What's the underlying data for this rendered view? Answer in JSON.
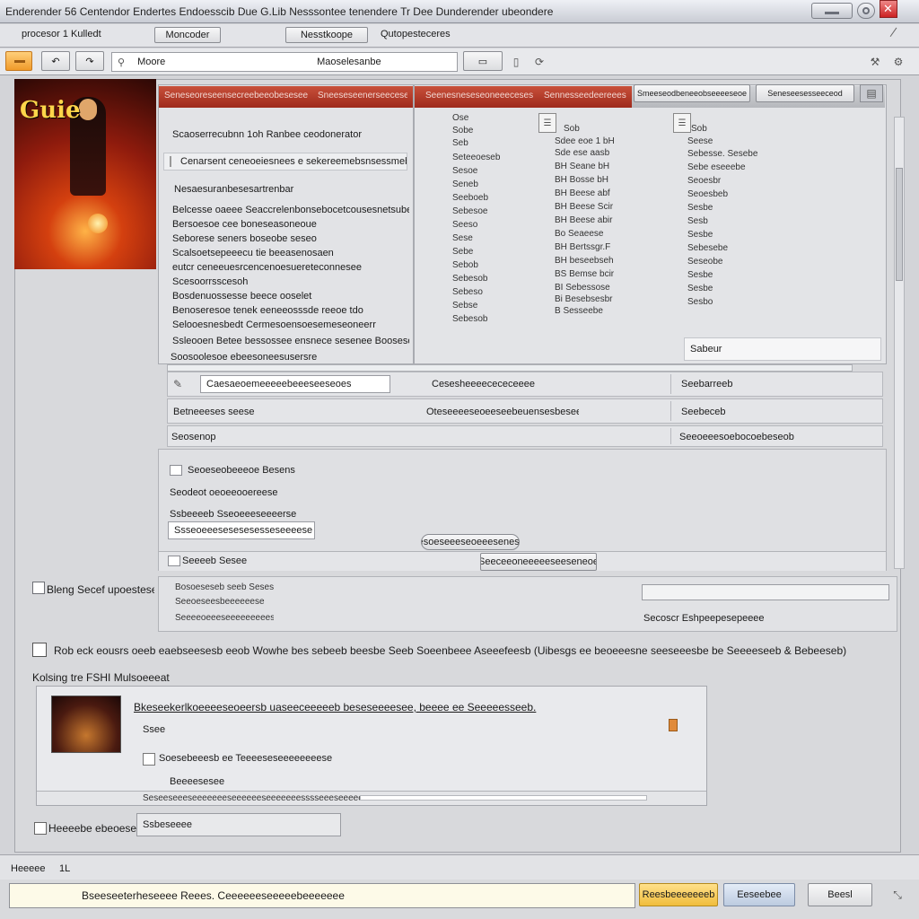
{
  "window": {
    "title": "Enderender 56 Centendor Endertes Endoesscib Due G.Lib Nesssontee tenendere Tr Dee Dunderender ubeondere"
  },
  "tabs": [
    "procesor 1 Kulledt",
    "Moncoder",
    "Nesstkoope",
    "Qutopesteceres"
  ],
  "toolbar": {
    "path": "Moore",
    "location": "Maoselesanbe"
  },
  "left_list": {
    "heading": "Scaoserrecubnn 1oh Ranbee ceodonerator",
    "search_text": "Cenarsent ceneoeiesnees e sekereemebsnsessmebsn",
    "sub_heading": "Nesaesuranbesesartrenbar",
    "rows": [
      "Belcesse oaeee Seaccrelenbonsebocetcousesnetsubersee",
      "Bersoesoe cee boneseasoneoue",
      "Seborese seners boseobe seseo",
      "Scalsoetsepeeecu tie beeasenosaen",
      "eutcr ceneeuesrcencenoesuereteconnesee",
      "Scesoorrsscesoh",
      "Bosdenuossesse beece ooselet",
      "Benoseresoe tenek eeneeosssde reeoe tdo",
      "Selooesnesbedt Cermesoensoesemeseoneerr",
      "Ssleooen Betee bessossee ensnece sesenee Boosesoeb beesbe"
    ],
    "footer": "Soosoolesoe ebeesoneesusersre"
  },
  "col_headers": [
    "Seneseoreseensecreebeeobesesee",
    "Sneeseseenerseecese",
    "Seenesneseseoneeecesese",
    "Sennesseedeereeeseee"
  ],
  "right_buttons": [
    "Smeeseodbeneeobseeeeseoe",
    "Seneseesesseeceod"
  ],
  "col2": {
    "head": [
      "Ose",
      "Sobe",
      "Seb"
    ],
    "rows": [
      "Seteeoeseb",
      "Sesoe",
      "Seneb",
      "Seeboeb",
      "Sebesoe",
      "Seeso",
      "Sese",
      "Sebe",
      "Sebob",
      "Sebesob",
      "Sebeso",
      "Sebse",
      "Sebesob"
    ]
  },
  "col3": {
    "head": [
      "Sob"
    ],
    "rows": [
      "Sdee eoe 1 bH",
      "Sde ese aasb",
      "BH Seane bH",
      "BH Bosse bH",
      "BH Beese abf",
      "BH Beese Scir",
      "BH Beese abir",
      "Bo Seaeese",
      "BH Bertssgr.F",
      "BH beseebseh",
      "BS Bemse bcir",
      "BI Sebessose",
      "Bi Besebsesbr",
      "B Sesseebe"
    ]
  },
  "col4": {
    "head": [
      "Sob"
    ],
    "rows": [
      "Seese",
      "Sebesse. Sesebe",
      "Sebe eseeebe",
      "Seoesbr",
      "Seoesbeb",
      "Sesbe",
      "Sesb",
      "Sesbe",
      "Sebesebe",
      "Seseobe",
      "Sesbe",
      "Sesbe",
      "Sesbo"
    ],
    "selected": "Sabeur"
  },
  "form_rows": [
    {
      "left": "Caesaeoemeeeeebeeeseeseoes",
      "mid": "Cesesheeeecececeeee",
      "right": "Seebarreeb"
    },
    {
      "left": "Betneeeses seese",
      "mid": "Oteseeeeseoeeseebeuensesbeseeeeseee",
      "right": "Seebeceb"
    },
    {
      "left": "Seosenop",
      "mid": "",
      "right": "Seeoeeesoebocoebeseob"
    }
  ],
  "sub_panel": {
    "title": "Seoeseobeeeoe Besens",
    "label": "Seodeot oeoeeooereese",
    "label2": "Ssbeeeeb Sseoeeeseeeerse",
    "field": "Ssseoeeesesesesesseseeeese",
    "ok_pill": "Oesoeseeeseoeeeseneseo",
    "check": "Seeeeb Sesee",
    "center_btn": "Seeceeoneeeeeseeseneoe"
  },
  "sec_mid": {
    "label": "Bleng Secef upoestesese",
    "rows": [
      "Bosoeseseb seeb Sesese",
      "Seeoeseesbeeeeeese",
      "Seeeeoeeeseeeeeeeeesee"
    ],
    "right": "Secoscr Eshpeepesepeeee"
  },
  "notice": "Rob eck eousrs oeeb eaebseesesb eeob Wowhe bes sebeeb beesbe Seeb Soeenbeee Aseeefeesb (Uibesgs ee beoeeesne seeseeesbe be Seeeeseeb & Bebeeseb)",
  "bottom_label": "Kolsing tre FSHI Mulsoeeeat",
  "media": {
    "title": "Bkeseekerlkoeeeeseoeersb uaseeceeeeeb beseseeeesee, beeee ee Seeeeesseeb.",
    "row1": "Ssee",
    "row2": "Soesebeeesb ee Teeeeseseeeeeeeese",
    "row3": "Beeeesesee",
    "footer": "Seseeseeeseeeeeeeseeeeeeseeeeeeesssseeeseeeeeeee"
  },
  "cat": {
    "label": "Heeeebe ebeoeseeb",
    "field": "Ssbeseeee"
  },
  "status": {
    "left": "Heeeee",
    "right": "1L"
  },
  "bottom_bar": {
    "input": "Bseeseeterheseeee Reees. Ceeeeeeseeeeebeeeeeee",
    "btn1": "Reesbeeeeeeeb",
    "btn2": "Eeseebee",
    "btn3": "Beesl"
  }
}
